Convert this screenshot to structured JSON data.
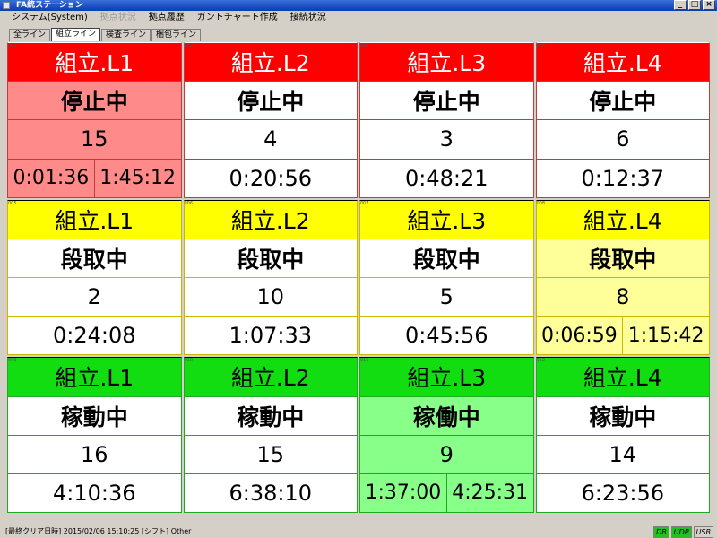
{
  "window": {
    "title": "FA統ステーション"
  },
  "menu": [
    {
      "label": "システム(System)",
      "enabled": true
    },
    {
      "label": "拠点状況",
      "enabled": false
    },
    {
      "label": "拠点履歴",
      "enabled": true
    },
    {
      "label": "ガントチャート作成",
      "enabled": true
    },
    {
      "label": "接続状況",
      "enabled": true
    }
  ],
  "tabs": [
    {
      "label": "全ライン",
      "active": false
    },
    {
      "label": "組立ライン",
      "active": true
    },
    {
      "label": "検査ライン",
      "active": false
    },
    {
      "label": "梱包ライン",
      "active": false
    }
  ],
  "rows": [
    {
      "color": "red",
      "panels": [
        {
          "corner": "001",
          "line": "組立.L1",
          "status": "停止中",
          "count": "15",
          "times": [
            "0:01:36",
            "1:45:12"
          ],
          "alert": true
        },
        {
          "corner": "002",
          "line": "組立.L2",
          "status": "停止中",
          "count": "4",
          "times": [
            "0:20:56"
          ],
          "alert": false
        },
        {
          "corner": "003",
          "line": "組立.L3",
          "status": "停止中",
          "count": "3",
          "times": [
            "0:48:21"
          ],
          "alert": false
        },
        {
          "corner": "004",
          "line": "組立.L4",
          "status": "停止中",
          "count": "6",
          "times": [
            "0:12:37"
          ],
          "alert": false
        }
      ]
    },
    {
      "color": "yellow",
      "panels": [
        {
          "corner": "005",
          "line": "組立.L1",
          "status": "段取中",
          "count": "2",
          "times": [
            "0:24:08"
          ],
          "alert": false
        },
        {
          "corner": "006",
          "line": "組立.L2",
          "status": "段取中",
          "count": "10",
          "times": [
            "1:07:33"
          ],
          "alert": false
        },
        {
          "corner": "007",
          "line": "組立.L3",
          "status": "段取中",
          "count": "5",
          "times": [
            "0:45:56"
          ],
          "alert": false
        },
        {
          "corner": "008",
          "line": "組立.L4",
          "status": "段取中",
          "count": "8",
          "times": [
            "0:06:59",
            "1:15:42"
          ],
          "alert": true
        }
      ]
    },
    {
      "color": "green",
      "panels": [
        {
          "corner": "009",
          "line": "組立.L1",
          "status": "稼動中",
          "count": "16",
          "times": [
            "4:10:36"
          ],
          "alert": false
        },
        {
          "corner": "010",
          "line": "組立.L2",
          "status": "稼動中",
          "count": "15",
          "times": [
            "6:38:10"
          ],
          "alert": false
        },
        {
          "corner": "011",
          "line": "組立.L3",
          "status": "稼働中",
          "count": "9",
          "times": [
            "1:37:00",
            "4:25:31"
          ],
          "alert": true
        },
        {
          "corner": "012",
          "line": "組立.L4",
          "status": "稼動中",
          "count": "14",
          "times": [
            "6:23:56"
          ],
          "alert": false
        }
      ]
    }
  ],
  "statusbar": {
    "text": "[最終クリア日時] 2015/02/06 15:10:25  [シフト] Other",
    "indicators": [
      {
        "label": "DB",
        "on": true
      },
      {
        "label": "UDP",
        "on": true
      },
      {
        "label": "USB",
        "on": false
      }
    ]
  }
}
